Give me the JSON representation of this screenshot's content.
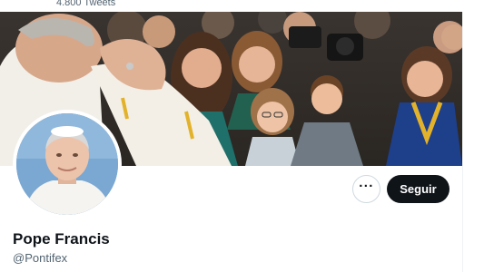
{
  "header": {
    "tweet_count": "4.800 Tweets"
  },
  "banner": {
    "alt": ""
  },
  "profile": {
    "display_name": "Pope Francis",
    "handle": "@Pontifex"
  },
  "actions": {
    "more_label": "···",
    "follow_label": "Seguir"
  },
  "colors": {
    "follow_bg": "#0f1419",
    "follow_text": "#ffffff",
    "secondary_text": "#536471",
    "border": "#cfd9de"
  },
  "icons": {
    "more": "more-horizontal-icon"
  }
}
